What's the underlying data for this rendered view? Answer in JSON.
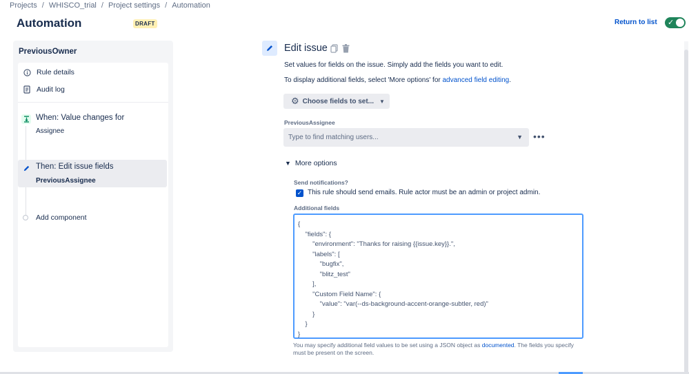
{
  "breadcrumb": [
    "Projects",
    "WHISCO_trial",
    "Project settings",
    "Automation"
  ],
  "breadcrumb_separator": "/",
  "page": {
    "title": "Automation",
    "status_badge": "DRAFT"
  },
  "header": {
    "return_link": "Return to list",
    "toggle_state": "on"
  },
  "sidebar": {
    "rule_name": "PreviousOwner",
    "items": [
      {
        "label": "Rule details",
        "icon": "info-icon"
      },
      {
        "label": "Audit log",
        "icon": "document-icon"
      }
    ],
    "steps": [
      {
        "title": "When: Value changes for",
        "subtitle": "Assignee",
        "icon": "trigger-icon",
        "selected": false
      },
      {
        "title": "Then: Edit issue fields",
        "subtitle": "PreviousAssignee",
        "icon": "pencil-icon",
        "selected": true
      }
    ],
    "add_component": "Add component"
  },
  "editor": {
    "title": "Edit issue",
    "description": "Set values for fields on the issue. Simply add the fields you want to edit.",
    "more_info_prefix": "To display additional fields, select 'More options' for ",
    "more_info_link": "advanced field editing",
    "more_info_suffix": ".",
    "choose_fields_button": "Choose fields to set...",
    "field": {
      "label": "PreviousAssignee",
      "placeholder": "Type to find matching users..."
    },
    "more_options": {
      "label": "More options",
      "send_notifications_label": "Send notifications?",
      "send_notifications_text": "This rule should send emails. Rule actor must be an admin or project admin.",
      "send_notifications_checked": true,
      "additional_fields_label": "Additional fields",
      "additional_fields_value": "{\n    \"fields\": {\n        \"environment\": \"Thanks for raising {{issue.key}}.\",\n        \"labels\": [\n            \"bugfix\",\n            \"blitz_test\"\n        ],\n        \"Custom Field Name\": {\n            \"value\": \"var(--ds-background-accent-orange-subtler, red)\"\n        }\n    }\n}",
      "helper_prefix": "You may specify additional field values to be set using a JSON object as ",
      "helper_link": "documented",
      "helper_suffix": ". The fields you specify must be present on the screen."
    }
  },
  "colors": {
    "accent": "#0052cc",
    "toggle_on": "#1f845a",
    "badge_bg": "#fff0b3",
    "focus_border": "#4c9aff"
  }
}
